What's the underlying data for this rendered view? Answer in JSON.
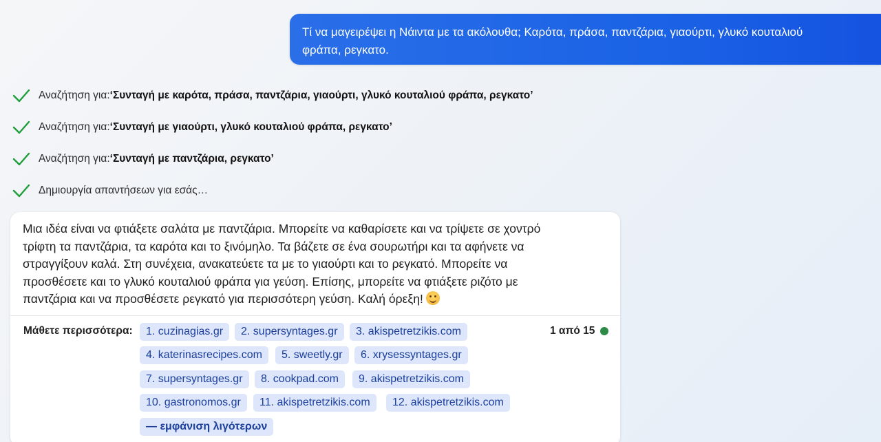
{
  "user_message": {
    "line1": "Τί να μαγειρέψει η Νάιντα με τα ακόλουθα; Καρότα, πράσα, παντζάρια, γιαούρτι, γλυκό κουταλιού",
    "line2": "φράπα, ρεγκατο."
  },
  "status_items": [
    {
      "prefix": "Αναζήτηση για: ",
      "query": "‘Συνταγή με καρότα, πράσα, παντζάρια, γιαούρτι, γλυκό κουταλιού φράπα, ρεγκατο’",
      "icon": "check-icon"
    },
    {
      "prefix": "Αναζήτηση για: ",
      "query": "‘Συνταγή με γιαούρτι, γλυκό κουταλιού φράπα, ρεγκατο’",
      "icon": "check-icon"
    },
    {
      "prefix": "Αναζήτηση για: ",
      "query": "‘Συνταγή με παντζάρια, ρεγκατο’",
      "icon": "check-icon"
    },
    {
      "prefix": "Δημιουργία απαντήσεων για εσάς…",
      "query": "",
      "icon": "check-icon"
    }
  ],
  "answer": {
    "lines": [
      "Μια ιδέα είναι να φτιάξετε σαλάτα με παντζάρια. Μπορείτε να καθαρίσετε και να τρίψετε σε χοντρό",
      "τρίφτη τα παντζάρια, τα καρότα και το ξινόμηλο. Τα βάζετε σε ένα σουρωτήρι και τα αφήνετε να",
      "στραγγίξουν καλά. Στη συνέχεια, ανακατεύετε τα με το γιαούρτι και το ρεγκατό. Μπορείτε να",
      "προσθέσετε και το γλυκό κουταλιού φράπα για γεύση. Επίσης, μπορείτε να φτιάξετε ριζότο με",
      "παντζάρια και να προσθέσετε ρεγκατό για περισσότερη γεύση. Καλή όρεξη!"
    ],
    "emoji": "smiling-face-emoji"
  },
  "learn_more": {
    "label": "Μάθετε περισσότερα:",
    "links": [
      "1. cuzinagias.gr",
      "2. supersyntages.gr",
      "3. akispetretzikis.com",
      "4. katerinasrecipes.com",
      "5. sweetly.gr",
      "6. xrysessyntages.gr",
      "7. supersyntages.gr",
      "8. cookpad.com",
      "9. akispetretzikis.com",
      "10. gastronomos.gr",
      "11. akispetretzikis.com",
      "12. akispetretzikis.com"
    ],
    "show_less": "— εμφάνιση λιγότερων",
    "page_count": "1 από 15"
  },
  "colors": {
    "accent_blue": "#1b63e6",
    "check_green": "#1e9e3a",
    "chip_bg": "#dde6fb",
    "chip_text": "#1b3f9b",
    "status_dot": "#2e8b47"
  }
}
